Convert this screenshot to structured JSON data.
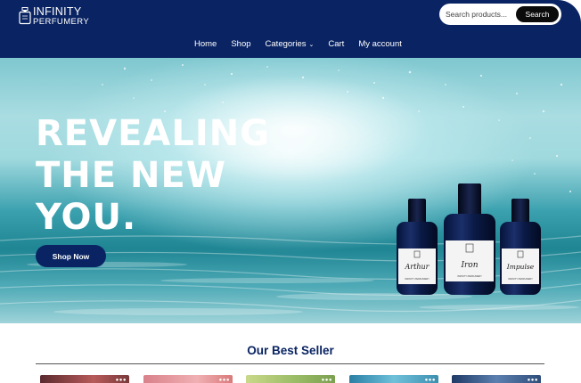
{
  "brand": {
    "line1": "INFINITY",
    "line2": "PERFUMERY"
  },
  "search": {
    "placeholder": "Search products...",
    "button_label": "Search"
  },
  "nav": [
    {
      "label": "Home"
    },
    {
      "label": "Shop"
    },
    {
      "label": "Categories",
      "has_dropdown": true
    },
    {
      "label": "Cart"
    },
    {
      "label": "My account"
    }
  ],
  "hero": {
    "title_lines": [
      "REVEALING",
      "THE NEW",
      "YOU."
    ],
    "cta_label": "Shop Now",
    "products": [
      {
        "name": "Arthur",
        "brand": "INFINITY PERFUMERY"
      },
      {
        "name": "Iron",
        "brand": "INFINITY PERFUMERY"
      },
      {
        "name": "Impulse",
        "brand": "INFINITY PERFUMERY"
      }
    ]
  },
  "best_seller": {
    "title": "Our Best Seller",
    "thumb_icon": "dots-icon",
    "thumbs": [
      {
        "color": "#7a3a3a"
      },
      {
        "color": "#d97a7a"
      },
      {
        "color": "#9fbf6a"
      },
      {
        "color": "#3d8fb0"
      },
      {
        "color": "#2f4e7a"
      }
    ]
  },
  "colors": {
    "navy": "#0a2463",
    "white": "#ffffff"
  }
}
